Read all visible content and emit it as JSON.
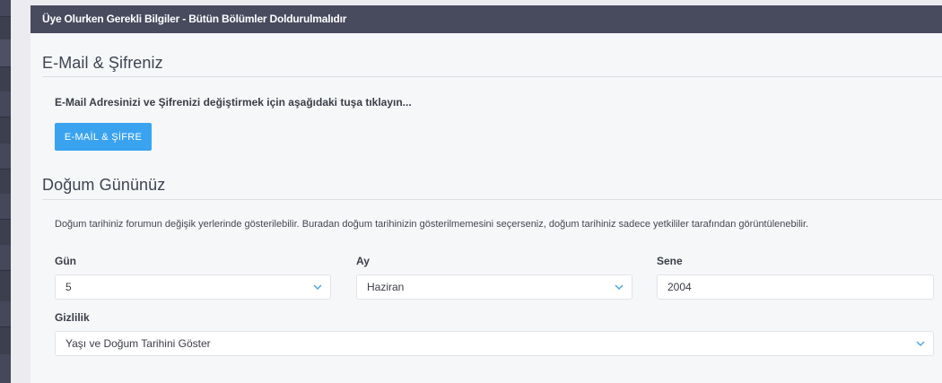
{
  "header": {
    "title": "Üye Olurken Gerekli Bilgiler - Bütün Bölümler Doldurulmalıdır"
  },
  "email_section": {
    "title": "E-Mail & Şifreniz",
    "note": "E-Mail Adresinizi ve Şifrenizi değiştirmek için aşağıdaki tuşa tıklayın...",
    "button_label": "E-MAİL & ŞİFRE"
  },
  "birthday_section": {
    "title": "Doğum Gününüz",
    "description": "Doğum tarihiniz forumun değişik yerlerinde gösterilebilir. Buradan doğum tarihinizin gösterilmemesini seçerseniz, doğum tarihiniz sadece yetkililer tarafından görüntülenebilir.",
    "day": {
      "label": "Gün",
      "value": "5"
    },
    "month": {
      "label": "Ay",
      "value": "Haziran"
    },
    "year": {
      "label": "Sene",
      "value": "2004"
    },
    "privacy": {
      "label": "Gizlilik",
      "value": "Yaşı ve Doğum Tarihini Göster"
    }
  },
  "colors": {
    "header_bg": "#484a5e",
    "button_bg": "#3aa3ef",
    "chevron": "#4aa3e6"
  },
  "icons": {
    "select_chevron": "chevron-down-icon"
  }
}
